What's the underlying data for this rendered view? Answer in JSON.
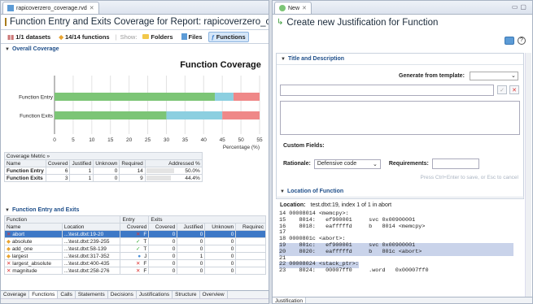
{
  "left": {
    "tab_label": "rapicoverzero_coverage.rvd",
    "title": "Function Entry and Exits Coverage for Report: rapicoverzero_cove",
    "toolbar": {
      "datasets": "1/1 datasets",
      "functions_count": "14/14 functions",
      "show_label": "Show:",
      "folders": "Folders",
      "files": "Files",
      "functions": "Functions"
    },
    "overall_section": "Overall Coverage",
    "chart_data": {
      "type": "bar",
      "title": "Function Coverage",
      "categories": [
        "Function Entry",
        "Function Exits"
      ],
      "series": [
        {
          "color": "#7cc576",
          "values": [
            43,
            30
          ]
        },
        {
          "color": "#8ccfe0",
          "values": [
            5,
            15
          ]
        },
        {
          "color": "#ef8888",
          "values": [
            52,
            55
          ]
        }
      ],
      "xlabel": "Percentage (%)",
      "xticks": [
        "0",
        "5",
        "10",
        "15",
        "20",
        "25",
        "30",
        "35",
        "40",
        "45",
        "50",
        "55"
      ],
      "xlim": [
        0,
        55
      ]
    },
    "metric_table": {
      "tab": "Coverage Metric",
      "headers": [
        "Name",
        "Covered",
        "Justified",
        "Unknown",
        "Required",
        "Addressed %"
      ],
      "rows": [
        {
          "name": "Function Entry",
          "covered": "6",
          "justified": "1",
          "unknown": "0",
          "required": "14",
          "addressed": "50.0%",
          "pct": 50.0
        },
        {
          "name": "Function Exits",
          "covered": "3",
          "justified": "1",
          "unknown": "0",
          "required": "9",
          "addressed": "44.4%",
          "pct": 44.4
        }
      ]
    },
    "entry_section": "Function Entry and Exits",
    "func_table": {
      "group_headers": [
        "Function",
        "Entry",
        "Exits"
      ],
      "headers": [
        "Name",
        "Location",
        "Covered",
        "Covered",
        "Justified",
        "Unknown",
        "Requirec"
      ],
      "rows": [
        {
          "name": "abort",
          "loc": "...\\test.dtxt:19-20",
          "mark": "✕",
          "markc": "red",
          "cov": "F",
          "covered": "0",
          "justified": "0",
          "unknown": "0",
          "icon": "red-x-icon"
        },
        {
          "name": "absolute",
          "loc": "...\\test.dtxt:239-255",
          "mark": "✓",
          "markc": "green",
          "cov": "T",
          "covered": "0",
          "justified": "0",
          "unknown": "0",
          "icon": "diamond-icon"
        },
        {
          "name": "add_one",
          "loc": "...\\test.dtxt:58-139",
          "mark": "✓",
          "markc": "green",
          "cov": "T",
          "covered": "0",
          "justified": "0",
          "unknown": "0",
          "icon": "diamond-icon"
        },
        {
          "name": "largest",
          "loc": "...\\test.dtxt:317-352",
          "mark": "●",
          "markc": "blue",
          "cov": "J",
          "covered": "0",
          "justified": "1",
          "unknown": "0",
          "icon": "diamond-icon"
        },
        {
          "name": "largest_absolute",
          "loc": "...\\test.dtxt:400-435",
          "mark": "✕",
          "markc": "red",
          "cov": "F",
          "covered": "0",
          "justified": "0",
          "unknown": "0",
          "icon": "red-x-icon"
        },
        {
          "name": "magnitude",
          "loc": "...\\test.dtxt:258-276",
          "mark": "✕",
          "markc": "red",
          "cov": "F",
          "covered": "0",
          "justified": "0",
          "unknown": "0",
          "icon": "red-x-icon"
        }
      ]
    },
    "bottom_tabs": [
      "Coverage",
      "Functions",
      "Calls",
      "Statements",
      "Decisions",
      "Justifications",
      "Structure",
      "Overview"
    ]
  },
  "right": {
    "tab_label": "New",
    "title": "Create new Justification for Function",
    "title_section": "Title and Description",
    "template_label": "Generate from template:",
    "custom_fields": "Custom Fields:",
    "rationale_label": "Rationale:",
    "rationale_value": "Defensive code",
    "requirements_label": "Requirements:",
    "hint": "Press Ctrl+Enter to save, or Esc to cancel",
    "location_section": "Location of Function",
    "location_label": "Location:",
    "location_value": "test.dtxt:19, index 1 of 1 in abort",
    "code_lines": [
      "14 00008014 <memcpy>:",
      "15    8014:   ef900001     svc 0x00900001",
      "16    8018:   eafffffd     b   8014 <memcpy>",
      "17",
      "18 0000801c <abort>:",
      "19    801c:   ef900001     svc 0x00900001",
      "20    8020:   eafffffd     b   801c <abort>",
      "21",
      "22 00008024 <stack_ptr>:",
      "23    8024:   00007ff0     .word   0x00007ff0"
    ],
    "bottom_tab": "Justification"
  }
}
